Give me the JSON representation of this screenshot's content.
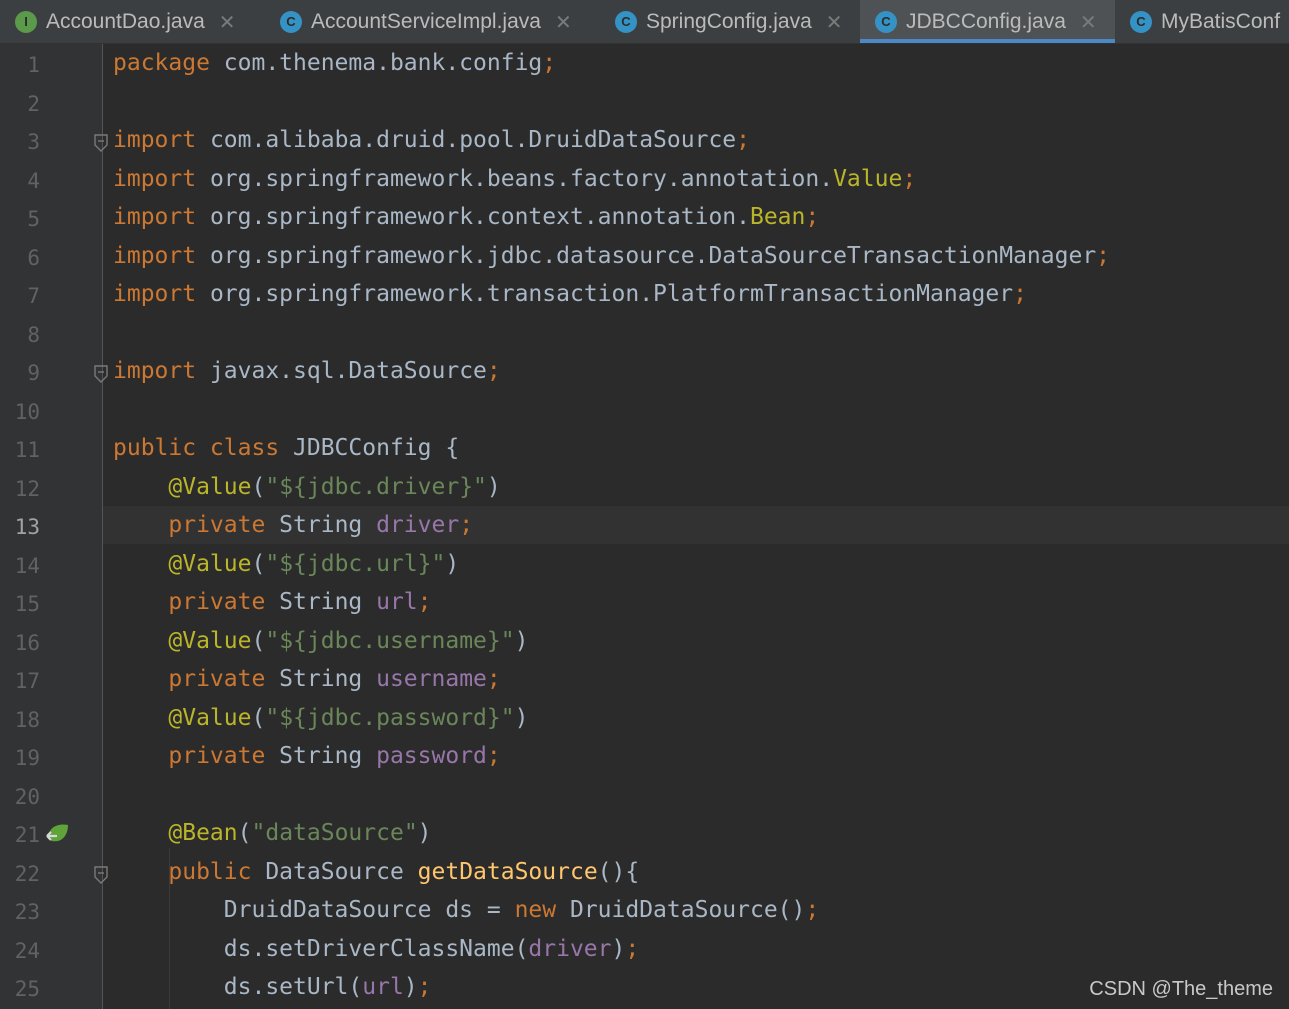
{
  "tabs": [
    {
      "label": "AccountDao.java",
      "icon": "interface-icon",
      "icon_letter": "I",
      "active": false
    },
    {
      "label": "AccountServiceImpl.java",
      "icon": "class-icon",
      "icon_letter": "C",
      "active": false
    },
    {
      "label": "SpringConfig.java",
      "icon": "class-icon",
      "icon_letter": "C",
      "active": false
    },
    {
      "label": "JDBCConfig.java",
      "icon": "class-icon",
      "icon_letter": "C",
      "active": true
    },
    {
      "label": "MyBatisConf",
      "icon": "class-icon",
      "icon_letter": "C",
      "active": false
    }
  ],
  "tab_close_glyph": "✕",
  "editor": {
    "current_line": 13,
    "line_numbers": [
      "1",
      "2",
      "3",
      "4",
      "5",
      "6",
      "7",
      "8",
      "9",
      "10",
      "11",
      "12",
      "13",
      "14",
      "15",
      "16",
      "17",
      "18",
      "19",
      "20",
      "21",
      "22",
      "23",
      "24",
      "25"
    ],
    "lines": [
      [
        {
          "t": "package",
          "c": "kw"
        },
        {
          "t": " com.thenema.bank.config",
          "c": ""
        },
        {
          "t": ";",
          "c": "kw"
        }
      ],
      [],
      [
        {
          "t": "import",
          "c": "kw"
        },
        {
          "t": " com.alibaba.druid.pool.DruidDataSource",
          "c": ""
        },
        {
          "t": ";",
          "c": "kw"
        }
      ],
      [
        {
          "t": "import",
          "c": "kw"
        },
        {
          "t": " org.springframework.beans.factory.annotation.",
          "c": ""
        },
        {
          "t": "Value",
          "c": "ann"
        },
        {
          "t": ";",
          "c": "kw"
        }
      ],
      [
        {
          "t": "import",
          "c": "kw"
        },
        {
          "t": " org.springframework.context.annotation.",
          "c": ""
        },
        {
          "t": "Bean",
          "c": "ann"
        },
        {
          "t": ";",
          "c": "kw"
        }
      ],
      [
        {
          "t": "import",
          "c": "kw"
        },
        {
          "t": " org.springframework.jdbc.datasource.DataSourceTransactionManager",
          "c": ""
        },
        {
          "t": ";",
          "c": "kw"
        }
      ],
      [
        {
          "t": "import",
          "c": "kw"
        },
        {
          "t": " org.springframework.transaction.PlatformTransactionManager",
          "c": ""
        },
        {
          "t": ";",
          "c": "kw"
        }
      ],
      [],
      [
        {
          "t": "import",
          "c": "kw"
        },
        {
          "t": " javax.sql.DataSource",
          "c": ""
        },
        {
          "t": ";",
          "c": "kw"
        }
      ],
      [],
      [
        {
          "t": "public class",
          "c": "kw"
        },
        {
          "t": " JDBCConfig {",
          "c": ""
        }
      ],
      [
        {
          "t": "    ",
          "c": ""
        },
        {
          "t": "@Value",
          "c": "ann"
        },
        {
          "t": "(",
          "c": ""
        },
        {
          "t": "\"${jdbc.driver}\"",
          "c": "str"
        },
        {
          "t": ")",
          "c": ""
        }
      ],
      [
        {
          "t": "    ",
          "c": ""
        },
        {
          "t": "private",
          "c": "kw"
        },
        {
          "t": " String ",
          "c": ""
        },
        {
          "t": "driver",
          "c": "fld"
        },
        {
          "t": ";",
          "c": "kw"
        }
      ],
      [
        {
          "t": "    ",
          "c": ""
        },
        {
          "t": "@Value",
          "c": "ann"
        },
        {
          "t": "(",
          "c": ""
        },
        {
          "t": "\"${jdbc.url}\"",
          "c": "str"
        },
        {
          "t": ")",
          "c": ""
        }
      ],
      [
        {
          "t": "    ",
          "c": ""
        },
        {
          "t": "private",
          "c": "kw"
        },
        {
          "t": " String ",
          "c": ""
        },
        {
          "t": "url",
          "c": "fld"
        },
        {
          "t": ";",
          "c": "kw"
        }
      ],
      [
        {
          "t": "    ",
          "c": ""
        },
        {
          "t": "@Value",
          "c": "ann"
        },
        {
          "t": "(",
          "c": ""
        },
        {
          "t": "\"${jdbc.username}\"",
          "c": "str"
        },
        {
          "t": ")",
          "c": ""
        }
      ],
      [
        {
          "t": "    ",
          "c": ""
        },
        {
          "t": "private",
          "c": "kw"
        },
        {
          "t": " String ",
          "c": ""
        },
        {
          "t": "username",
          "c": "fld"
        },
        {
          "t": ";",
          "c": "kw"
        }
      ],
      [
        {
          "t": "    ",
          "c": ""
        },
        {
          "t": "@Value",
          "c": "ann"
        },
        {
          "t": "(",
          "c": ""
        },
        {
          "t": "\"${jdbc.password}\"",
          "c": "str"
        },
        {
          "t": ")",
          "c": ""
        }
      ],
      [
        {
          "t": "    ",
          "c": ""
        },
        {
          "t": "private",
          "c": "kw"
        },
        {
          "t": " String ",
          "c": ""
        },
        {
          "t": "password",
          "c": "fld"
        },
        {
          "t": ";",
          "c": "kw"
        }
      ],
      [],
      [
        {
          "t": "    ",
          "c": ""
        },
        {
          "t": "@Bean",
          "c": "ann"
        },
        {
          "t": "(",
          "c": ""
        },
        {
          "t": "\"dataSource\"",
          "c": "str"
        },
        {
          "t": ")",
          "c": ""
        }
      ],
      [
        {
          "t": "    ",
          "c": ""
        },
        {
          "t": "public",
          "c": "kw"
        },
        {
          "t": " DataSource ",
          "c": ""
        },
        {
          "t": "getDataSource",
          "c": "fn"
        },
        {
          "t": "(){",
          "c": ""
        }
      ],
      [
        {
          "t": "        DruidDataSource ds = ",
          "c": ""
        },
        {
          "t": "new",
          "c": "kw"
        },
        {
          "t": " DruidDataSource()",
          "c": ""
        },
        {
          "t": ";",
          "c": "kw"
        }
      ],
      [
        {
          "t": "        ds.setDriverClassName(",
          "c": ""
        },
        {
          "t": "driver",
          "c": "fld"
        },
        {
          "t": ")",
          "c": ""
        },
        {
          "t": ";",
          "c": "kw"
        }
      ],
      [
        {
          "t": "        ds.setUrl(",
          "c": ""
        },
        {
          "t": "url",
          "c": "fld"
        },
        {
          "t": ")",
          "c": ""
        },
        {
          "t": ";",
          "c": "kw"
        }
      ]
    ],
    "fold_markers_at_lines": [
      3,
      9,
      22
    ],
    "bean_gutter_icon_line": 21,
    "bean_gutter_icon": "spring-bean-icon"
  },
  "watermark": "CSDN @The_theme",
  "colors": {
    "keyword": "#cc7832",
    "annotation": "#bbb529",
    "string": "#6a8759",
    "field": "#9876aa",
    "method": "#ffc66d",
    "plain": "#a9b7c6",
    "active_tab_underline": "#4a88c7"
  }
}
